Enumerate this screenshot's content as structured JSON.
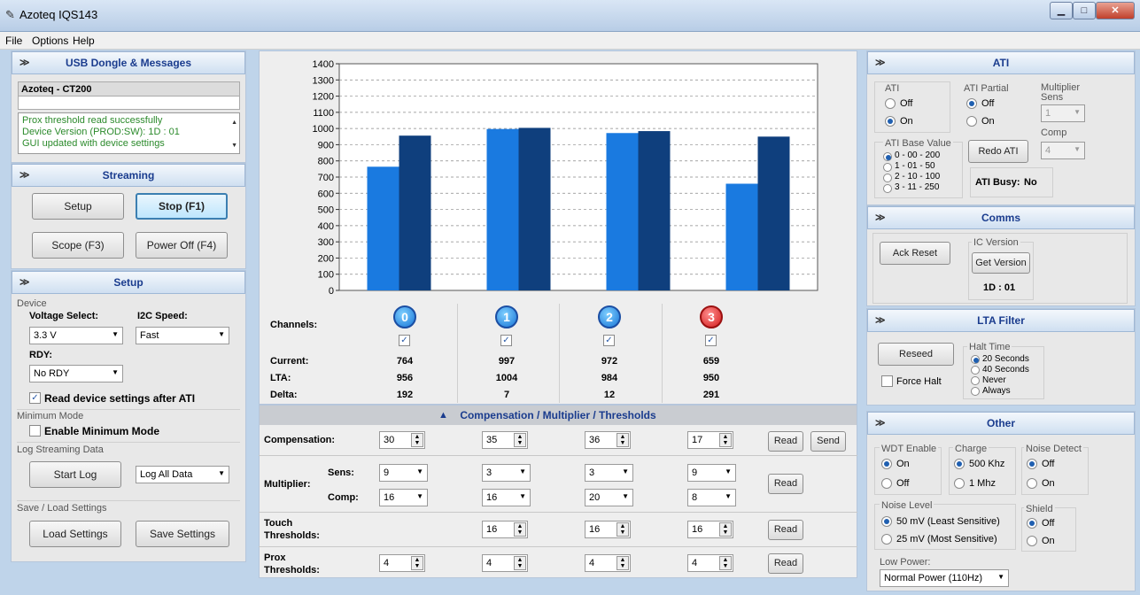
{
  "window": {
    "title": "Azoteq IQS143",
    "min": "▁",
    "max": "□",
    "close": "✕"
  },
  "menu": [
    "File",
    "Options",
    "Help"
  ],
  "usb": {
    "header": "USB Dongle & Messages",
    "device": "Azoteq - CT200",
    "messages": [
      "Prox threshold read successfully",
      "Device Version (PROD:SW):  1D : 01",
      "GUI updated with device settings"
    ]
  },
  "streaming": {
    "header": "Streaming",
    "setup": "Setup",
    "stop": "Stop (F1)",
    "scope": "Scope (F3)",
    "power_off": "Power Off (F4)"
  },
  "setup": {
    "header": "Setup",
    "device_label": "Device",
    "voltage_label": "Voltage Select:",
    "voltage_value": "3.3 V",
    "i2c_label": "I2C Speed:",
    "i2c_value": "Fast",
    "rdy_label": "RDY:",
    "rdy_value": "No RDY",
    "read_after_ati": "Read device settings after ATI",
    "min_mode_label": "Minimum Mode",
    "enable_min_mode": "Enable Minimum Mode",
    "log_label": "Log Streaming Data",
    "start_log": "Start Log",
    "log_option": "Log All Data",
    "save_load_label": "Save / Load Settings",
    "load": "Load Settings",
    "save": "Save Settings"
  },
  "chart_data": {
    "type": "bar",
    "categories": [
      "0",
      "1",
      "2",
      "3"
    ],
    "series": [
      {
        "values": [
          764,
          997,
          972,
          659
        ],
        "color": "#1a7ae0"
      },
      {
        "values": [
          956,
          1004,
          984,
          950
        ],
        "color": "#0f3f7d"
      }
    ],
    "ylim": [
      0,
      1400
    ],
    "yticks": [
      "0",
      "100",
      "200",
      "300",
      "400",
      "500",
      "600",
      "700",
      "800",
      "900",
      "1000",
      "1100",
      "1200",
      "1300",
      "1400"
    ],
    "grid": true
  },
  "channels": {
    "label": "Channels:",
    "current_label": "Current:",
    "lta_label": "LTA:",
    "delta_label": "Delta:",
    "items": [
      {
        "num": "0",
        "current": "764",
        "lta": "956",
        "delta": "192"
      },
      {
        "num": "1",
        "current": "997",
        "lta": "1004",
        "delta": "7"
      },
      {
        "num": "2",
        "current": "972",
        "lta": "984",
        "delta": "12"
      },
      {
        "num": "3",
        "current": "659",
        "lta": "950",
        "delta": "291"
      }
    ]
  },
  "cmt": {
    "header": "Compensation / Multiplier / Thresholds",
    "compensation_label": "Compensation:",
    "compensation": [
      "30",
      "35",
      "36",
      "17"
    ],
    "multiplier_label": "Multiplier:",
    "sens_label": "Sens:",
    "comp_label": "Comp:",
    "sens": [
      "9",
      "3",
      "3",
      "9"
    ],
    "comp": [
      "16",
      "16",
      "20",
      "8"
    ],
    "touch_label": "Touch",
    "thresholds_label": "Thresholds:",
    "touch": [
      "16",
      "16",
      "16"
    ],
    "prox_label": "Prox",
    "prox": [
      "4",
      "4",
      "4",
      "4"
    ],
    "read": "Read",
    "send": "Send"
  },
  "ati": {
    "header": "ATI",
    "ati_label": "ATI",
    "off": "Off",
    "on": "On",
    "partial_label": "ATI Partial",
    "mult_sens_label": "Multiplier Sens",
    "mult_sens_value": "1",
    "comp_label": "Comp",
    "comp_value": "4",
    "base_label": "ATI Base Value",
    "base_options": [
      "0 - 00 - 200",
      "1 - 01 - 50",
      "2 - 10 - 100",
      "3 - 11 - 250"
    ],
    "redo": "Redo ATI",
    "busy_label": "ATI Busy:",
    "busy_value": "No"
  },
  "comms": {
    "header": "Comms",
    "ack_reset": "Ack Reset",
    "ic_version_label": "IC Version",
    "get_version": "Get Version",
    "version": "1D : 01"
  },
  "lta": {
    "header": "LTA Filter",
    "reseed": "Reseed",
    "force_halt": "Force Halt",
    "halt_time_label": "Halt Time",
    "halt_options": [
      "20 Seconds",
      "40 Seconds",
      "Never",
      "Always"
    ]
  },
  "other": {
    "header": "Other",
    "wdt_label": "WDT Enable",
    "on": "On",
    "off": "Off",
    "charge_label": "Charge",
    "charge_options": [
      "500 Khz",
      "1 Mhz"
    ],
    "noise_detect_label": "Noise Detect",
    "noise_level_label": "Noise Level",
    "noise_options": [
      "50 mV (Least Sensitive)",
      "25 mV (Most Sensitive)"
    ],
    "shield_label": "Shield",
    "low_power_label": "Low Power:",
    "low_power_value": "Normal Power (110Hz)"
  }
}
